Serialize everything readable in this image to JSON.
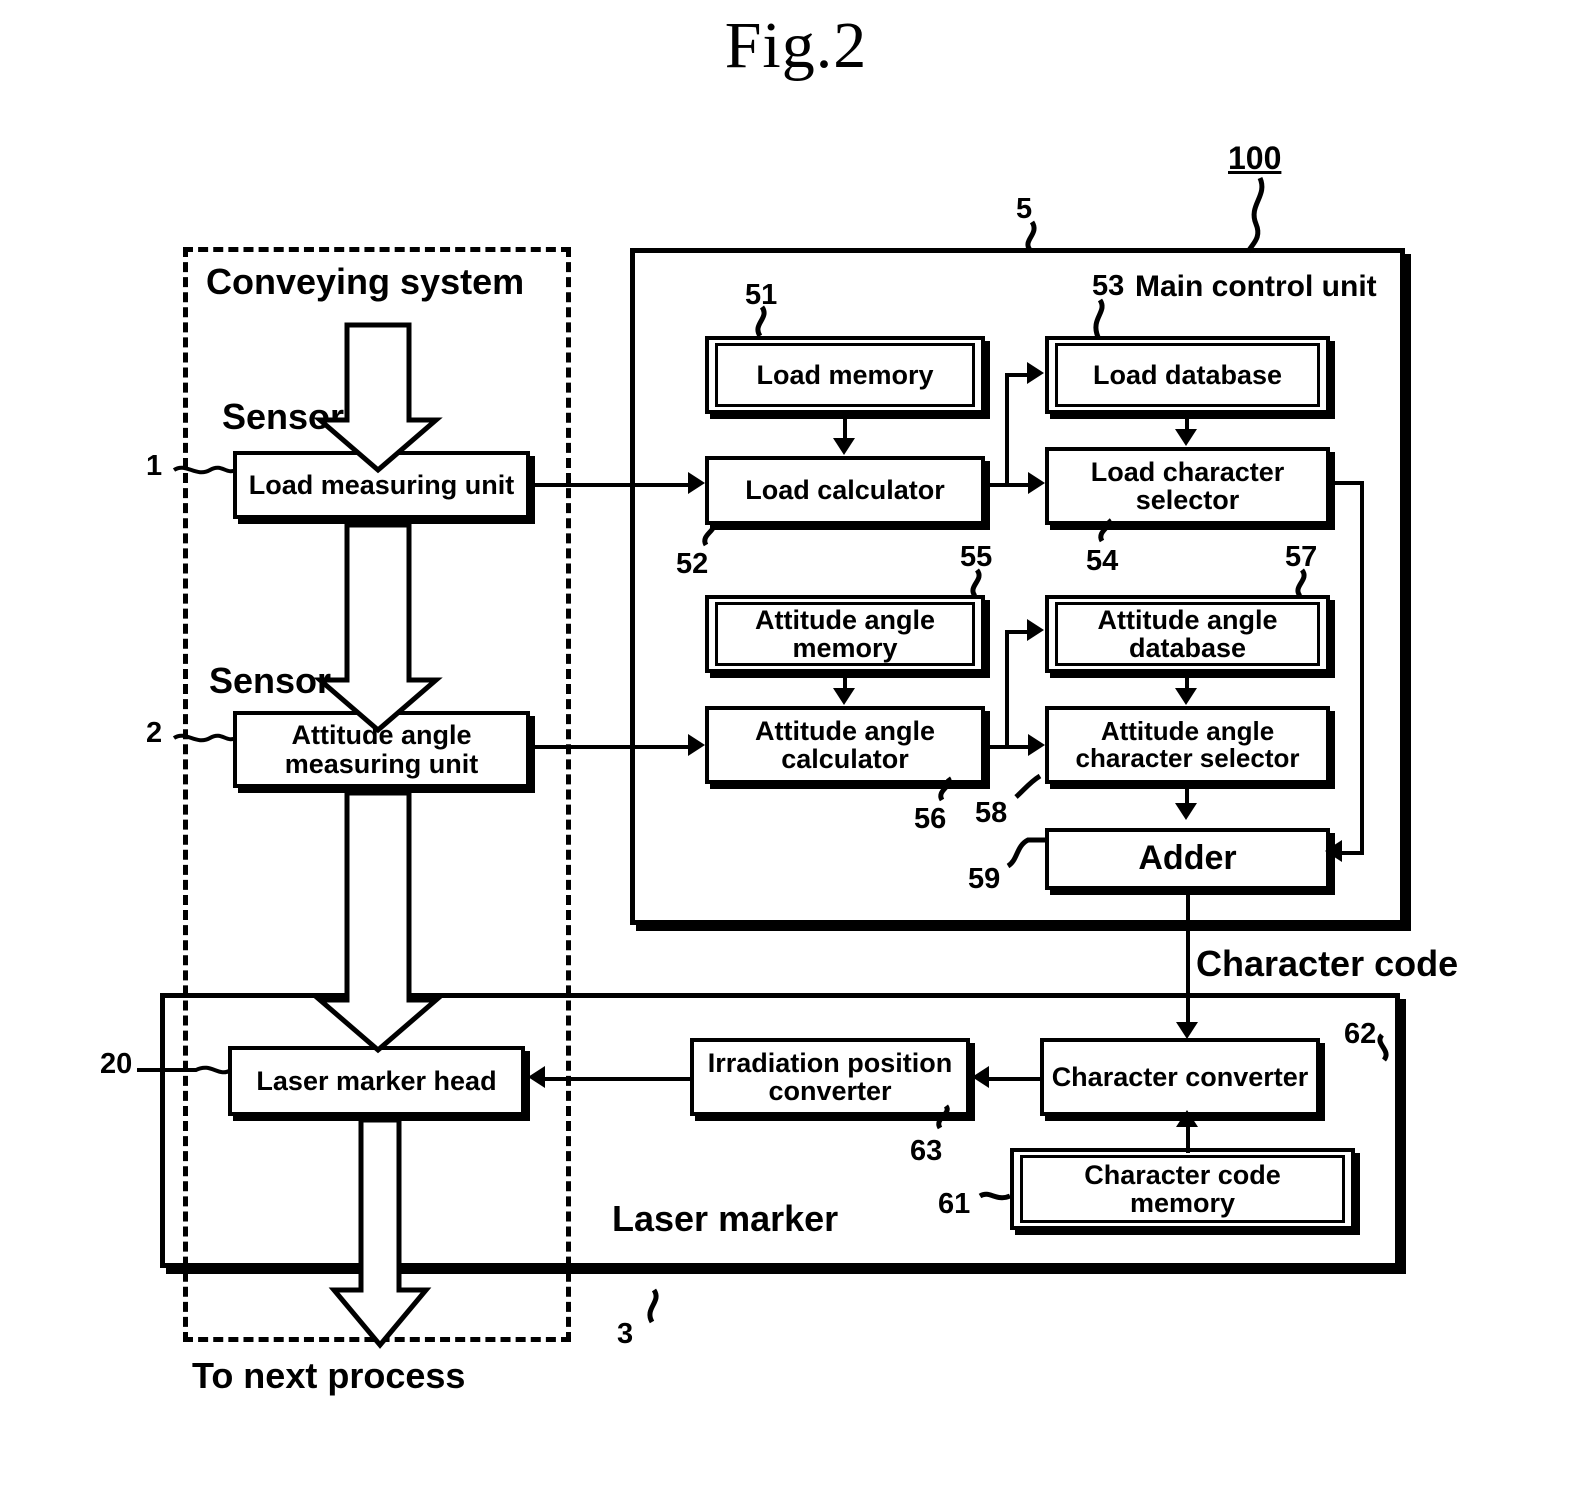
{
  "figure": {
    "title": "Fig.2"
  },
  "labels": {
    "conveying_system": "Conveying system",
    "sensor_1": "Sensor",
    "sensor_2": "Sensor",
    "main_control_unit": "Main control unit",
    "laser_marker": "Laser marker",
    "character_code": "Character code",
    "to_next_process": "To next process"
  },
  "refs": {
    "system": "100",
    "main_control_unit": "5",
    "load_measuring_unit": "1",
    "attitude_measuring_unit": "2",
    "laser_marker": "3",
    "laser_marker_head": "20",
    "load_memory": "51",
    "load_calculator": "52",
    "load_database": "53",
    "load_character_selector": "54",
    "attitude_angle_memory": "55",
    "attitude_angle_calculator": "56",
    "attitude_angle_database": "57",
    "attitude_angle_character_selector": "58",
    "adder": "59",
    "character_code_memory": "61",
    "character_converter": "62",
    "irradiation_position_converter": "63"
  },
  "blocks": {
    "load_measuring_unit": "Load measuring unit",
    "attitude_measuring_unit_l1": "Attitude angle",
    "attitude_measuring_unit_l2": "measuring unit",
    "load_memory": "Load memory",
    "load_calculator": "Load calculator",
    "load_database": "Load database",
    "load_character_selector_l1": "Load character",
    "load_character_selector_l2": "selector",
    "attitude_angle_memory_l1": "Attitude angle",
    "attitude_angle_memory_l2": "memory",
    "attitude_angle_calculator_l1": "Attitude angle",
    "attitude_angle_calculator_l2": "calculator",
    "attitude_angle_database_l1": "Attitude angle",
    "attitude_angle_database_l2": "database",
    "attitude_angle_character_selector_l1": "Attitude angle",
    "attitude_angle_character_selector_l2": "character selector",
    "adder": "Adder",
    "laser_marker_head": "Laser marker head",
    "irradiation_position_converter_l1": "Irradiation position",
    "irradiation_position_converter_l2": "converter",
    "character_converter": "Character converter",
    "character_code_memory_l1": "Character code",
    "character_code_memory_l2": "memory"
  },
  "colors": {
    "ink": "#000000",
    "paper": "#ffffff"
  }
}
